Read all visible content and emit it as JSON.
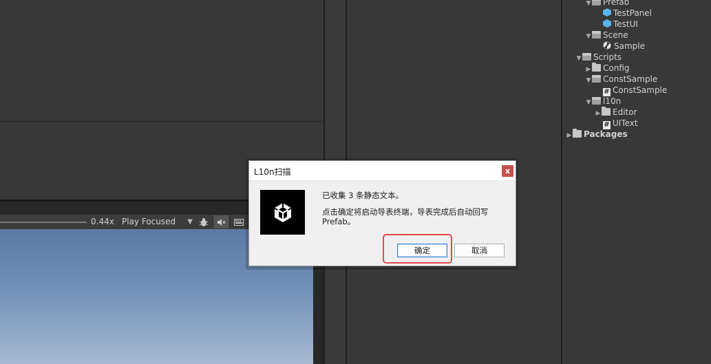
{
  "game_view": {
    "scale_value": "0.44x",
    "play_mode": "Play Focused",
    "bug_icon": "bug-icon",
    "mute_icon": "mute-audio-icon",
    "stats_icon": "stats-keyboard-icon"
  },
  "project_tree": {
    "items": [
      {
        "label": "Prefab",
        "icon": "folder-open-icon",
        "expanded": true
      },
      {
        "label": "TestPanel",
        "icon": "prefab-icon"
      },
      {
        "label": "TestUI",
        "icon": "prefab-icon"
      },
      {
        "label": "Scene",
        "icon": "folder-open-icon",
        "expanded": true
      },
      {
        "label": "Sample",
        "icon": "scene-icon"
      },
      {
        "label": "Scripts",
        "icon": "folder-open-icon",
        "expanded": true
      },
      {
        "label": "Config",
        "icon": "folder-icon",
        "expanded": false
      },
      {
        "label": "ConstSample",
        "icon": "folder-open-icon",
        "expanded": true
      },
      {
        "label": "ConstSample",
        "icon": "script-icon"
      },
      {
        "label": "l10n",
        "icon": "folder-open-icon",
        "expanded": true
      },
      {
        "label": "Editor",
        "icon": "folder-icon",
        "expanded": false
      },
      {
        "label": "UIText",
        "icon": "script-icon"
      },
      {
        "label": "Packages",
        "icon": "folder-icon",
        "expanded": false
      }
    ]
  },
  "dialog": {
    "title": "L10n扫描",
    "close_label": "x",
    "message_line1": "已收集 3 条静态文本。",
    "message_line2": "点击确定将启动导表终端，导表完成后自动回写 Prefab。",
    "ok_label": "确定",
    "cancel_label": "取消",
    "logo": "unity-logo-icon",
    "highlight_color": "#e04b4b"
  }
}
